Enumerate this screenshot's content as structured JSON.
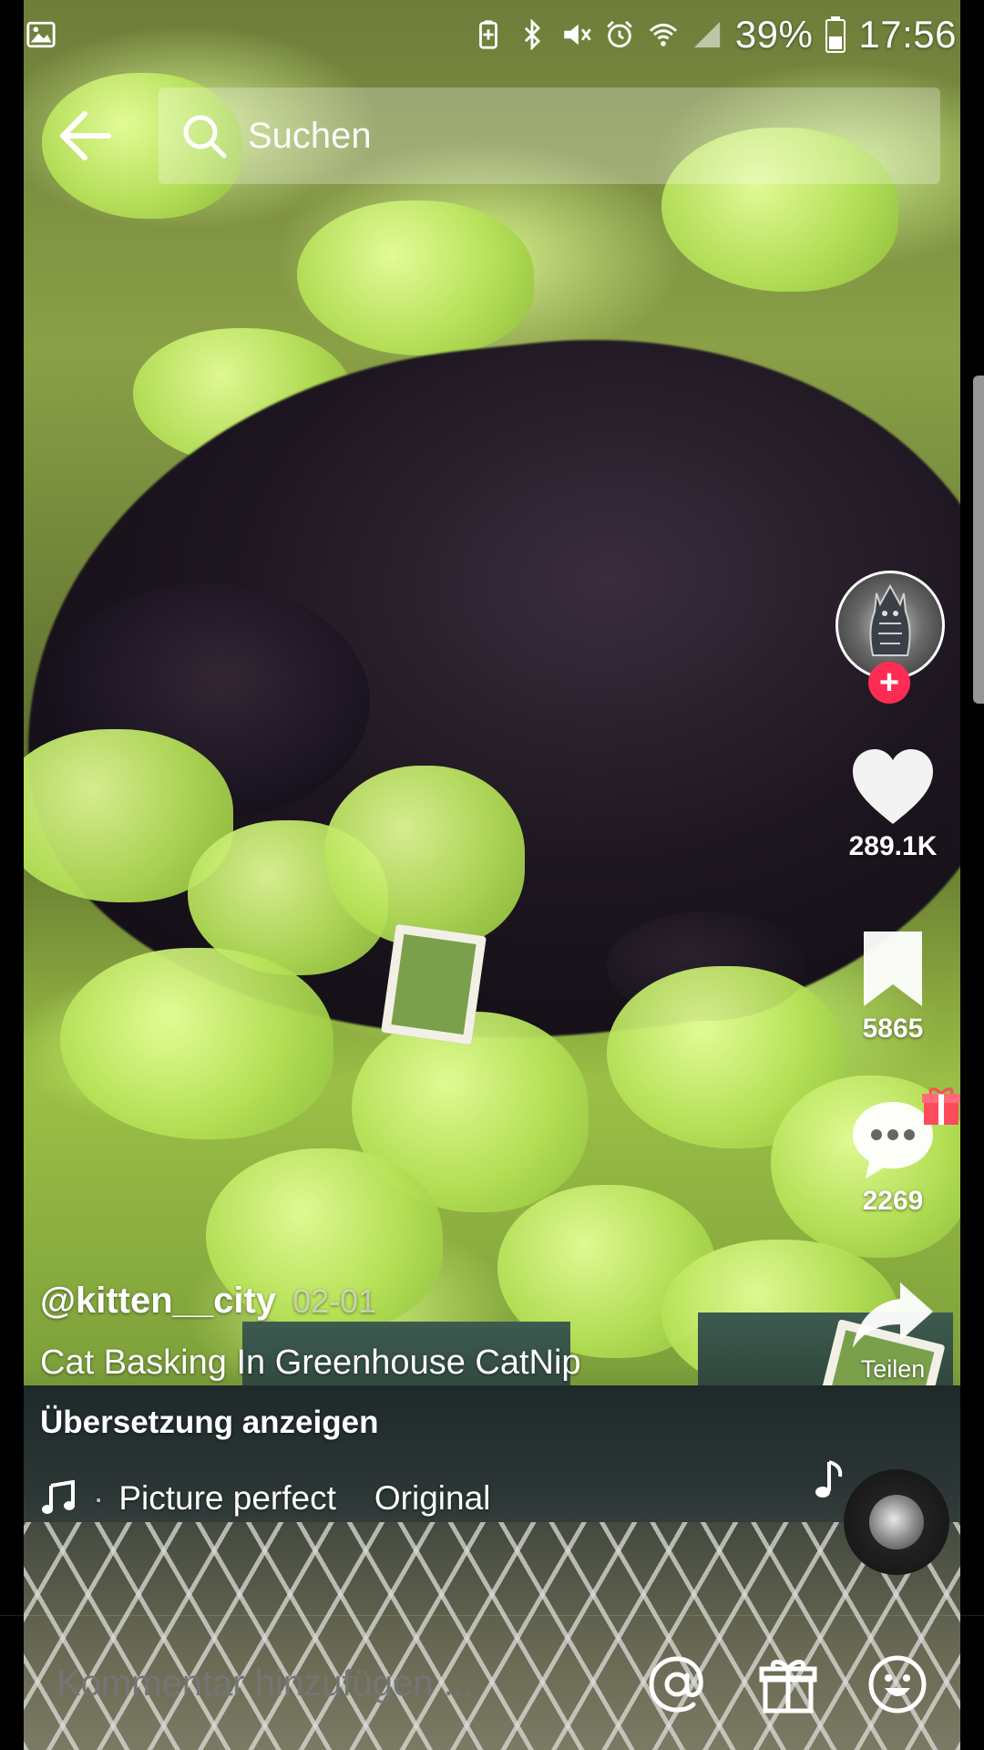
{
  "status_bar": {
    "battery_percent": "39%",
    "time": "17:56"
  },
  "search": {
    "placeholder": "Suchen"
  },
  "video": {
    "author": "@kitten__city",
    "date": "02-01",
    "description": "Cat Basking In Greenhouse CatNip",
    "translate_label": "Übersetzung anzeigen",
    "music_title": "Picture perfect",
    "music_source": "Original"
  },
  "actions": {
    "likes": "289.1K",
    "saves": "5865",
    "comments": "2269",
    "share_label": "Teilen"
  },
  "comment_bar": {
    "placeholder": "Kommentar hinzufügen ..."
  },
  "colors": {
    "follow_accent": "#fe2c55",
    "gift_accent": "#ff4b5c"
  },
  "icons": {
    "back": "arrow-left-icon",
    "search": "search-icon",
    "like": "heart-icon",
    "save": "bookmark-icon",
    "comment": "chat-bubble-icon",
    "share": "share-arrow-icon",
    "music": "music-note-icon",
    "mention": "at-sign-icon",
    "gift": "gift-icon",
    "emoji": "smiley-icon"
  }
}
